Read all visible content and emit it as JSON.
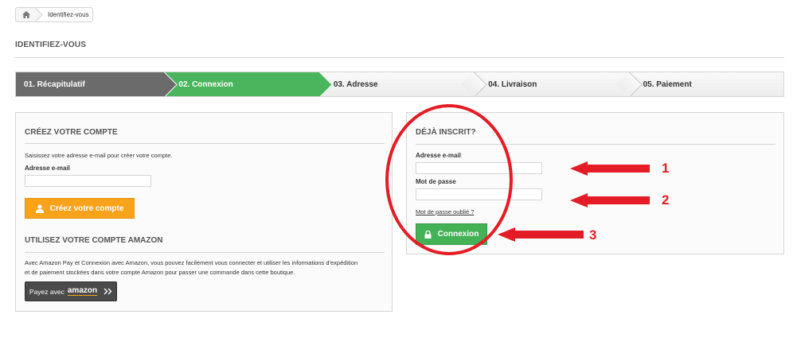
{
  "breadcrumb": {
    "home_icon": "home-icon",
    "current": "Identifiez-vous"
  },
  "page": {
    "title": "IDENTIFIEZ-VOUS"
  },
  "steps": [
    {
      "label": "01. Récapitulatif",
      "state": "done"
    },
    {
      "label": "02. Connexion",
      "state": "current"
    },
    {
      "label": "03. Adresse",
      "state": "todo"
    },
    {
      "label": "04. Livraison",
      "state": "todo"
    },
    {
      "label": "05. Paiement",
      "state": "todo"
    }
  ],
  "create_account": {
    "heading": "CRÉEZ VOTRE COMPTE",
    "intro": "Saisissez votre adresse e-mail pour créer votre compte.",
    "email_label": "Adresse e-mail",
    "email_value": "",
    "button_label": "Créez votre compte",
    "button_icon": "user-icon"
  },
  "amazon": {
    "heading": "UTILISEZ VOTRE COMPTE AMAZON",
    "description_line1": "Avec Amazon Pay et Connexion avec Amazon, vous pouvez facilement vous connecter et utiliser les informations d'expédition",
    "description_line2": "et de paiement stockées dans votre compte Amazon pour passer une commande dans cette boutique.",
    "button_prefix": "Payez avec",
    "button_brand": "amazon",
    "button_icon": "double-chevron-right-icon"
  },
  "login": {
    "heading": "DÉJÀ INSCRIT?",
    "email_label": "Adresse e-mail",
    "email_value": "",
    "password_label": "Mot de passe",
    "password_value": "",
    "forgot_link": "Mot de passe oublié ?",
    "button_label": "Connexion",
    "button_icon": "lock-icon"
  },
  "annotations": {
    "n1": "1",
    "n2": "2",
    "n3": "3",
    "color": "#e41c25"
  },
  "colors": {
    "green": "#4ab55c",
    "orange": "#f9a31b",
    "dark_step": "#6b6b6b"
  }
}
